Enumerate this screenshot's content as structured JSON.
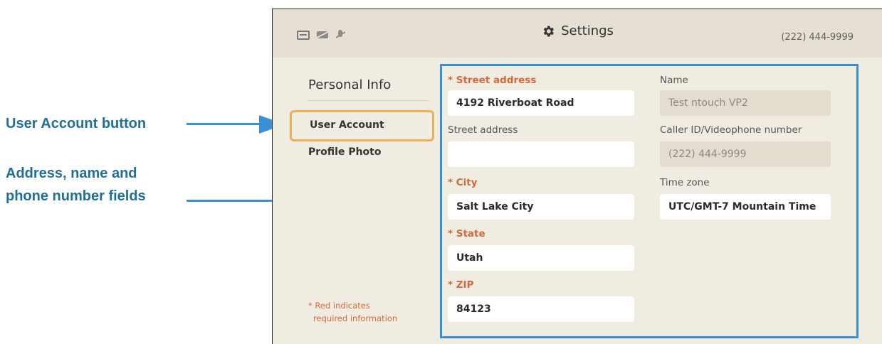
{
  "annotations": {
    "user_account_button": "User Account button",
    "fields_line1": "Address, name and",
    "fields_line2": "phone number fields"
  },
  "header": {
    "title": "Settings",
    "phone": "(222) 444-9999",
    "status_icons": [
      "screen-icon",
      "camera-off-icon",
      "mic-off-icon"
    ]
  },
  "sidebar": {
    "section_title": "Personal Info",
    "items": [
      {
        "label": "User Account",
        "selected": true
      },
      {
        "label": "Profile Photo",
        "selected": false
      }
    ],
    "footnote_line1": "* Red indicates",
    "footnote_line2": "required information"
  },
  "form": {
    "street1": {
      "label": "* Street address",
      "value": "4192 Riverboat Road"
    },
    "street2": {
      "label": "Street address",
      "value": ""
    },
    "city": {
      "label": "* City",
      "value": "Salt Lake City"
    },
    "state": {
      "label": "* State",
      "value": "Utah"
    },
    "zip": {
      "label": "* ZIP",
      "value": "84123"
    },
    "name": {
      "label": "Name",
      "value": "Test ntouch VP2"
    },
    "caller_id": {
      "label": "Caller ID/Videophone number",
      "value": "(222) 444-9999"
    },
    "time_zone": {
      "label": "Time zone",
      "value": "UTC/GMT-7 Mountain Time"
    }
  },
  "colors": {
    "accent_blue": "#3b8fd9",
    "selected_orange": "#f0ae5a",
    "required_red": "#d2693a",
    "callout_text": "#1f6f9a"
  }
}
